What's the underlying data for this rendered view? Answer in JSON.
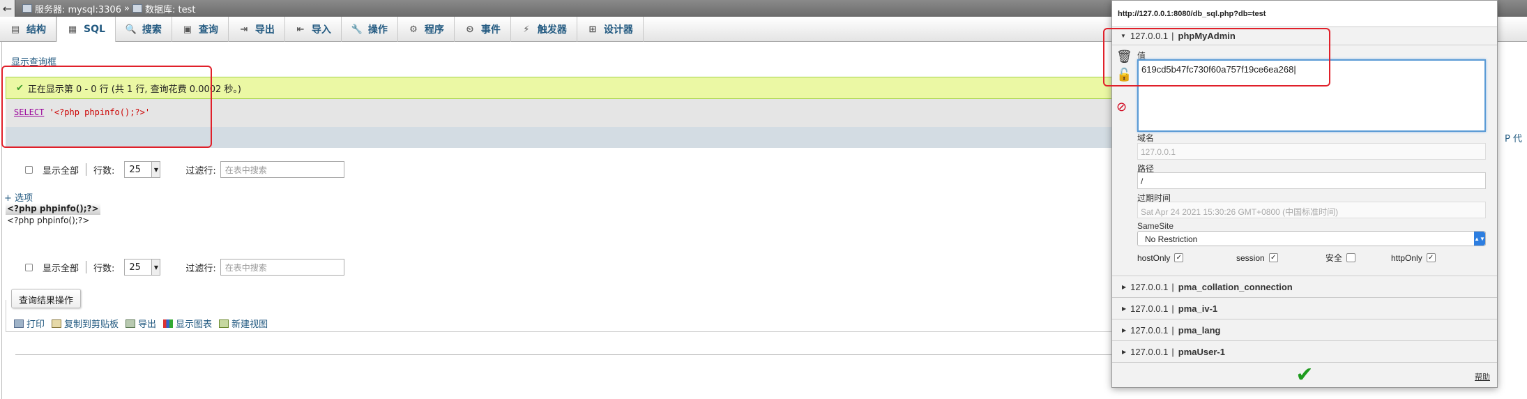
{
  "breadcrumb": {
    "back_glyph": "←",
    "server": "服务器: mysql:3306",
    "separator": "»",
    "database": "数据库: test"
  },
  "tabs": [
    {
      "label": "结构",
      "icon": "structure-icon",
      "glyph": "▤"
    },
    {
      "label": "SQL",
      "icon": "sql-icon",
      "glyph": "▦"
    },
    {
      "label": "搜索",
      "icon": "search-icon",
      "glyph": "🔍"
    },
    {
      "label": "查询",
      "icon": "query-icon",
      "glyph": "▣"
    },
    {
      "label": "导出",
      "icon": "export-icon",
      "glyph": "⇥"
    },
    {
      "label": "导入",
      "icon": "import-icon",
      "glyph": "⇤"
    },
    {
      "label": "操作",
      "icon": "operations-icon",
      "glyph": "🔧"
    },
    {
      "label": "程序",
      "icon": "routines-icon",
      "glyph": "⚙"
    },
    {
      "label": "事件",
      "icon": "events-icon",
      "glyph": "⏲"
    },
    {
      "label": "触发器",
      "icon": "triggers-icon",
      "glyph": "⚡"
    },
    {
      "label": "设计器",
      "icon": "designer-icon",
      "glyph": "⊞"
    }
  ],
  "main": {
    "show_query": "显示查询框",
    "notice": "正在显示第 0 - 0 行 (共 1 行, 查询花费 0.0002 秒。)",
    "sql_keyword": "SELECT",
    "sql_string": "'<?php phpinfo();?>'",
    "nav": {
      "show_all": "显示全部",
      "rows_label": "行数:",
      "rows_value": "25",
      "filter_label": "过滤行:",
      "filter_placeholder": "在表中搜索"
    },
    "options": "+ 选项",
    "column_header": "<?php phpinfo();?>",
    "cell_value": "<?php phpinfo();?>",
    "query_ops_title": "查询结果操作",
    "query_ops": [
      "打印",
      "复制到剪贴板",
      "导出",
      "显示图表",
      "新建视图"
    ],
    "right_cut_text": "P 代"
  },
  "cookie_panel": {
    "url": "http://127.0.0.1:8080/db_sql.php?db=test",
    "active": {
      "domain": "127.0.0.1",
      "sep": "|",
      "name": "phpMyAdmin"
    },
    "value_label": "值",
    "value": "619cd5b47fc730f60a757f19ce6ea268",
    "domain_label": "域名",
    "domain_value": "127.0.0.1",
    "path_label": "路径",
    "path_value": "/",
    "expiry_label": "过期时间",
    "expiry_value": "Sat Apr 24 2021 15:30:26 GMT+0800 (中国标准时间)",
    "samesite_label": "SameSite",
    "samesite_value": "No Restriction",
    "flags": [
      {
        "label": "hostOnly",
        "checked": "✓"
      },
      {
        "label": "session",
        "checked": "✓"
      },
      {
        "label": "安全",
        "checked": ""
      },
      {
        "label": "httpOnly",
        "checked": "✓"
      }
    ],
    "others": [
      {
        "domain": "127.0.0.1",
        "name": "pma_collation_connection"
      },
      {
        "domain": "127.0.0.1",
        "name": "pma_iv-1"
      },
      {
        "domain": "127.0.0.1",
        "name": "pma_lang"
      },
      {
        "domain": "127.0.0.1",
        "name": "pmaUser-1"
      }
    ],
    "help": "帮助"
  },
  "colors": {
    "accent": "#235a81",
    "notice_bg": "#ebf8a4",
    "highlight": "#e0202a",
    "confirm": "#1e9b1e"
  }
}
